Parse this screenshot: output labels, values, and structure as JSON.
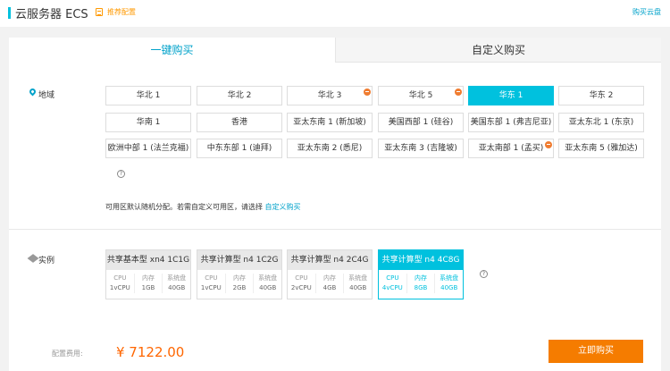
{
  "header": {
    "title": "云服务器 ECS",
    "recommend_label": "推荐配置",
    "right_link": "购买云盘"
  },
  "tabs": [
    {
      "label": "一键购买",
      "active": true
    },
    {
      "label": "自定义购买",
      "active": false
    }
  ],
  "region": {
    "label": "地域",
    "options": [
      {
        "label": "华北 1",
        "selected": false,
        "badge": false
      },
      {
        "label": "华北 2",
        "selected": false,
        "badge": false
      },
      {
        "label": "华北 3",
        "selected": false,
        "badge": true
      },
      {
        "label": "华北 5",
        "selected": false,
        "badge": true
      },
      {
        "label": "华东 1",
        "selected": true,
        "badge": false
      },
      {
        "label": "华东 2",
        "selected": false,
        "badge": false
      },
      {
        "label": "华南 1",
        "selected": false,
        "badge": false
      },
      {
        "label": "香港",
        "selected": false,
        "badge": false
      },
      {
        "label": "亚太东南 1 (新加坡)",
        "selected": false,
        "badge": false
      },
      {
        "label": "美国西部 1 (硅谷)",
        "selected": false,
        "badge": false
      },
      {
        "label": "美国东部 1 (弗吉尼亚)",
        "selected": false,
        "badge": false
      },
      {
        "label": "亚太东北 1 (东京)",
        "selected": false,
        "badge": false
      },
      {
        "label": "欧洲中部 1 (法兰克福)",
        "selected": false,
        "badge": false
      },
      {
        "label": "中东东部 1 (迪拜)",
        "selected": false,
        "badge": false
      },
      {
        "label": "亚太东南 2 (悉尼)",
        "selected": false,
        "badge": false
      },
      {
        "label": "亚太东南 3 (吉隆坡)",
        "selected": false,
        "badge": false
      },
      {
        "label": "亚太南部 1 (孟买)",
        "selected": false,
        "badge": true
      },
      {
        "label": "亚太东南 5 (雅加达)",
        "selected": false,
        "badge": false
      }
    ],
    "help_glyph": "?",
    "note_text": "可用区默认随机分配。若需自定义可用区，请选择",
    "note_link": "自定义购买"
  },
  "instance": {
    "label": "实例",
    "help_glyph": "?",
    "spec_headers": [
      "CPU",
      "内存",
      "系统盘"
    ],
    "options": [
      {
        "name": "共享基本型 xn4 1C1G",
        "cpu": "1vCPU",
        "mem": "1GB",
        "disk": "40GB",
        "selected": false
      },
      {
        "name": "共享计算型 n4 1C2G",
        "cpu": "1vCPU",
        "mem": "2GB",
        "disk": "40GB",
        "selected": false
      },
      {
        "name": "共享计算型 n4 2C4G",
        "cpu": "2vCPU",
        "mem": "4GB",
        "disk": "40GB",
        "selected": false
      },
      {
        "name": "共享计算型 n4 4C8G",
        "cpu": "4vCPU",
        "mem": "8GB",
        "disk": "40GB",
        "selected": true
      }
    ]
  },
  "footer": {
    "fee_label": "配置费用:",
    "price": "¥ 7122.00",
    "buy_label": "立即购买"
  },
  "colors": {
    "accent": "#00c1de",
    "link": "#00a2ca",
    "price": "#ff6600",
    "buy_button": "#f57c00",
    "badge": "#f07c30"
  }
}
